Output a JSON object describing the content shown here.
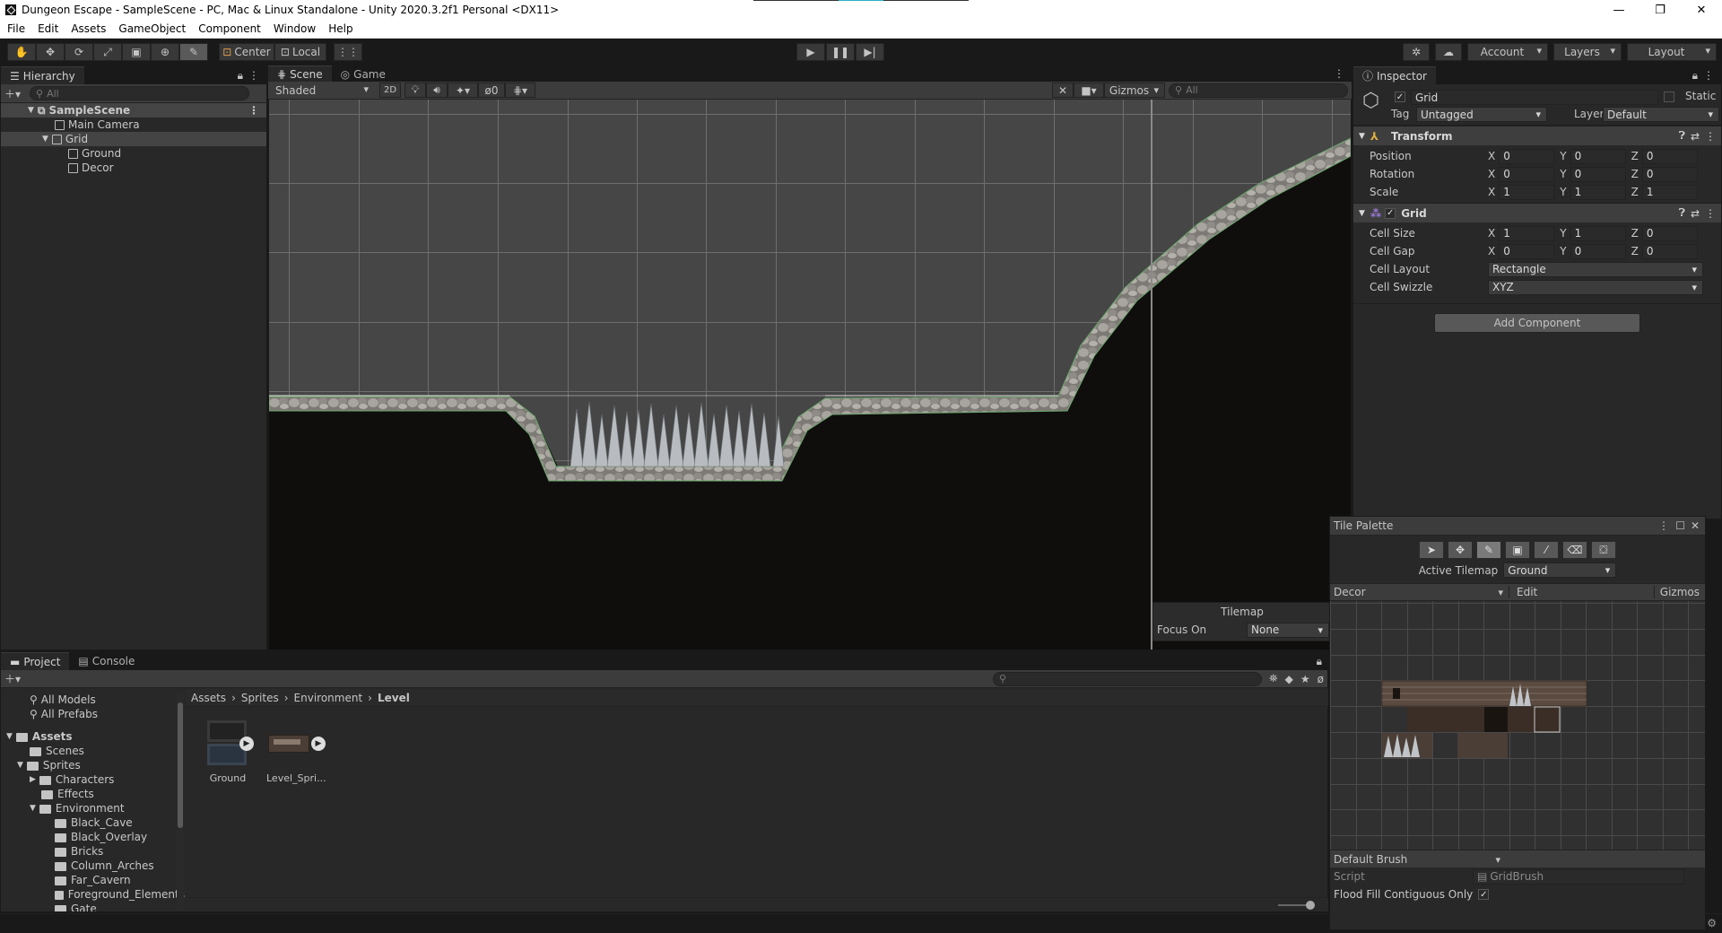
{
  "window": {
    "title": "Dungeon Escape - SampleScene - PC, Mac & Linux Standalone - Unity 2020.3.2f1 Personal <DX11>"
  },
  "menu": [
    "File",
    "Edit",
    "Assets",
    "GameObject",
    "Component",
    "Window",
    "Help"
  ],
  "toolbar": {
    "pivot_label": "Center",
    "space_label": "Local",
    "account_label": "Account",
    "layers_label": "Layers",
    "layout_label": "Layout"
  },
  "hierarchy": {
    "tab": "Hierarchy",
    "search_placeholder": "All",
    "scene": "SampleScene",
    "items": [
      "Main Camera",
      "Grid",
      "Ground",
      "Decor"
    ]
  },
  "scene": {
    "tabs": [
      "Scene",
      "Game"
    ],
    "shading": "Shaded",
    "mode_2d": "2D",
    "hidden_count": "0",
    "gizmos": "Gizmos",
    "search_placeholder": "All",
    "overlay": {
      "title": "Tilemap",
      "focus_label": "Focus On",
      "focus_value": "None"
    }
  },
  "inspector": {
    "tab": "Inspector",
    "object_name": "Grid",
    "static_label": "Static",
    "tag_label": "Tag",
    "tag_value": "Untagged",
    "layer_label": "Layer",
    "layer_value": "Default",
    "transform": {
      "title": "Transform",
      "rows": [
        {
          "label": "Position",
          "x": "0",
          "y": "0",
          "z": "0"
        },
        {
          "label": "Rotation",
          "x": "0",
          "y": "0",
          "z": "0"
        },
        {
          "label": "Scale",
          "x": "1",
          "y": "1",
          "z": "1"
        }
      ]
    },
    "grid": {
      "title": "Grid",
      "cell_size": {
        "label": "Cell Size",
        "x": "1",
        "y": "1",
        "z": "0"
      },
      "cell_gap": {
        "label": "Cell Gap",
        "x": "0",
        "y": "0",
        "z": "0"
      },
      "cell_layout": {
        "label": "Cell Layout",
        "value": "Rectangle"
      },
      "cell_swizzle": {
        "label": "Cell Swizzle",
        "value": "XYZ"
      }
    },
    "add_component": "Add Component",
    "axis_x": "X",
    "axis_y": "Y",
    "axis_z": "Z"
  },
  "tile_palette": {
    "title": "Tile Palette",
    "active_tilemap_label": "Active Tilemap",
    "active_tilemap_value": "Ground",
    "palette": "Decor",
    "edit": "Edit",
    "gizmos": "Gizmos",
    "brush": "Default Brush",
    "script_label": "Script",
    "script_value": "GridBrush",
    "flood_label": "Flood Fill Contiguous Only"
  },
  "project": {
    "tabs": [
      "Project",
      "Console"
    ],
    "favorites": [
      "All Models",
      "All Prefabs"
    ],
    "tree": {
      "assets": "Assets",
      "scenes": "Scenes",
      "sprites": "Sprites",
      "characters": "Characters",
      "effects": "Effects",
      "environment": "Environment",
      "env_children": [
        "Black_Cave",
        "Black_Overlay",
        "Bricks",
        "Column_Arches",
        "Far_Cavern",
        "Foreground_Elements",
        "Gate"
      ]
    },
    "breadcrumb": [
      "Assets",
      "Sprites",
      "Environment",
      "Level"
    ],
    "assets": [
      "Ground",
      "Level_Spri..."
    ]
  },
  "colors": {
    "accent": "#2ab1c7",
    "panel": "#282828",
    "selection": "#444444"
  }
}
